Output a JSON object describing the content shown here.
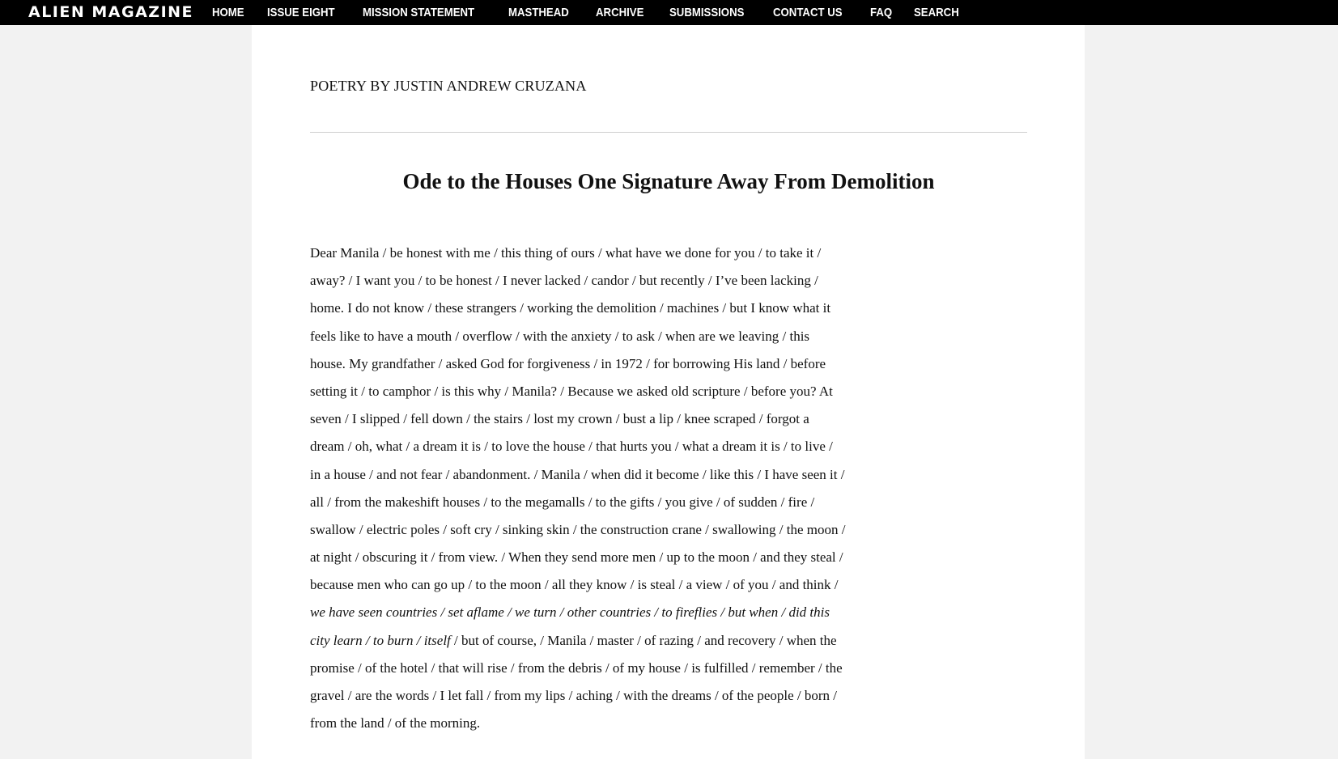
{
  "header": {
    "brand": "ALIEN MAGAZINE",
    "nav": [
      "HOME",
      "ISSUE EIGHT",
      "MISSION STATEMENT",
      "MASTHEAD",
      "ARCHIVE",
      "SUBMISSIONS",
      "CONTACT US",
      "FAQ",
      "SEARCH"
    ]
  },
  "article": {
    "byline": "POETRY BY JUSTIN ANDREW CRUZANA",
    "title": "Ode to the Houses One Signature Away From Demolition",
    "lines": [
      "Dear Manila / be honest with me / this thing of ours / what have we done for you / to take it /",
      "away? / I want you / to be honest / I never lacked / candor / but recently / I’ve been lacking /",
      "home. I do not know / these strangers / working the demolition / machines / but I know what it",
      "feels like to have a mouth / overflow / with the anxiety / to ask / when are we leaving / this",
      "house. My grandfather / asked God for forgiveness / in 1972 / for borrowing His land / before",
      "setting it / to camphor / is this why / Manila? / Because we asked old scripture / before you? At",
      "seven / I slipped / fell down / the stairs / lost my crown / bust a lip / knee scraped / forgot a",
      "dream / oh, what / a dream it is / to love the house / that hurts you / what a dream it is / to live /",
      "in a house / and not fear / abandonment. / Manila / when did it become / like this / I have seen it /",
      "all / from the makeshift houses / to the megamalls / to the gifts / you give / of sudden / fire /",
      "swallow / electric poles / soft cry / sinking skin / the construction crane / swallowing / the moon /",
      "at night / obscuring it / from view. / When they send more men / up to the moon / and they steal /",
      "because men who can go up / to the moon / all they know / is steal / a view / of you / and think /"
    ],
    "italic_line": "we have seen countries / set aflame / we turn / other countries / to fireflies / but when / did this",
    "mixed_line": {
      "italic": "city learn / to burn / itself",
      "rest": " / but of course, / Manila / master / of razing / and recovery / when the"
    },
    "tail_lines": [
      "promise / of the hotel / that will rise / from the debris / of my house / is fulfilled / remember / the",
      "gravel / are the words / I let fall / from my lips / aching / with the dreams / of the people / born /",
      "from the land / of the morning."
    ]
  }
}
